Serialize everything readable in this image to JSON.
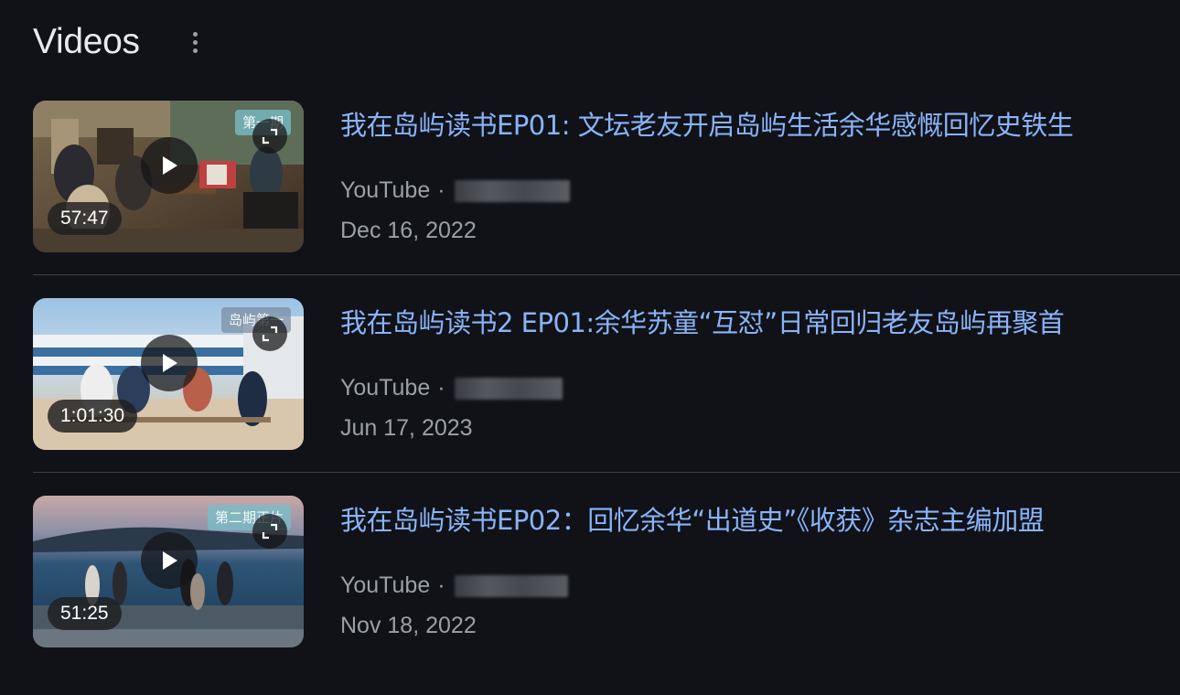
{
  "section": {
    "title": "Videos",
    "menu_icon": "more-vert-icon"
  },
  "videos": [
    {
      "title": "我在岛屿读书EP01: 文坛老友开启岛屿生活余华感慨回忆史铁生",
      "source": "YouTube",
      "separator": "·",
      "date": "Dec 16, 2022",
      "duration": "57:47",
      "thumb_tag": "第一期"
    },
    {
      "title": "我在岛屿读书2 EP01:余华苏童“互怼”日常回归老友岛屿再聚首",
      "source": "YouTube",
      "separator": "·",
      "date": "Jun 17, 2023",
      "duration": "1:01:30",
      "thumb_tag": "岛屿第一"
    },
    {
      "title": "我在岛屿读书EP02：回忆余华“出道史”《收获》杂志主编加盟",
      "source": "YouTube",
      "separator": "·",
      "date": "Nov 18, 2022",
      "duration": "51:25",
      "thumb_tag": "第二期正片"
    }
  ],
  "colors": {
    "background": "#101218",
    "title_link": "#8ab4f8",
    "meta_text": "#9aa0a6",
    "heading": "#e8eaed"
  }
}
